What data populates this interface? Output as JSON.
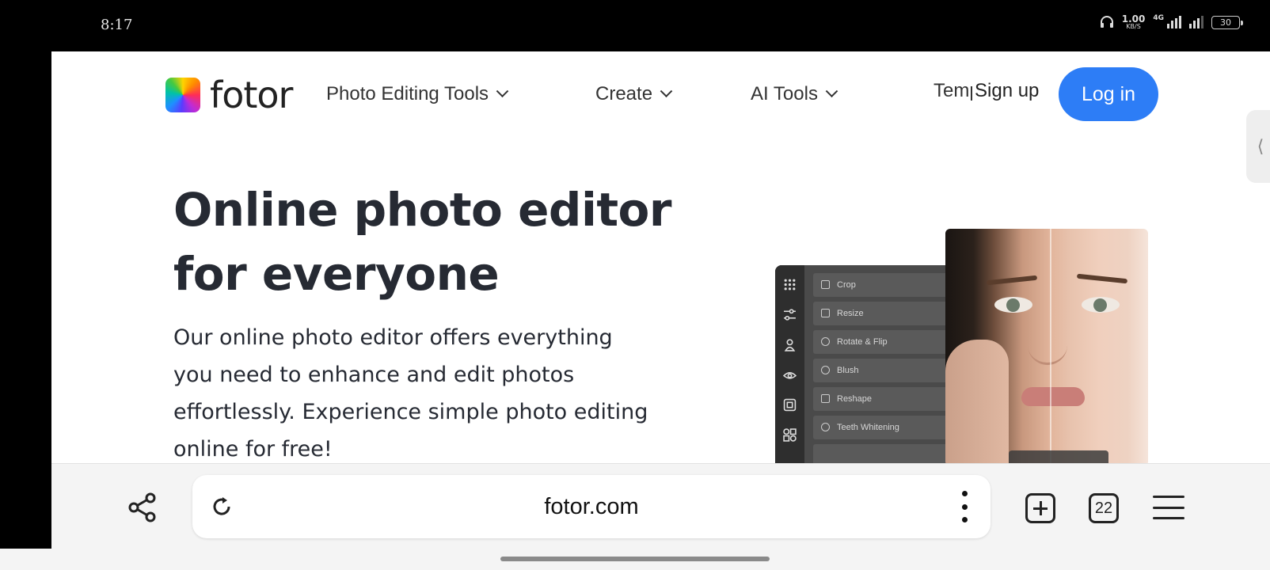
{
  "status_bar": {
    "time": "8:17",
    "speed_value": "1.00",
    "speed_unit": "KB/S",
    "network": "4G",
    "battery": "30"
  },
  "nav": {
    "logo_text": "fotor",
    "items": [
      {
        "label": "Photo Editing Tools"
      },
      {
        "label": "Create"
      },
      {
        "label": "AI Tools"
      },
      {
        "label": "Templates"
      }
    ],
    "signup_label": "Sign up",
    "login_label": "Log in"
  },
  "side_tab_glyph": "⟨",
  "hero": {
    "title_line1": "Online photo editor",
    "title_line2": "for everyone",
    "description": "Our online photo editor offers everything you need to enhance and edit photos effortlessly. Experience simple photo editing online for free!"
  },
  "editor_tools": [
    "Crop",
    "Resize",
    "Rotate & Flip",
    "Blush",
    "Reshape",
    "Teeth Whitening"
  ],
  "browser": {
    "url": "fotor.com",
    "tab_count": "22"
  },
  "colors": {
    "accent": "#2d7df6",
    "title": "#262a33"
  }
}
